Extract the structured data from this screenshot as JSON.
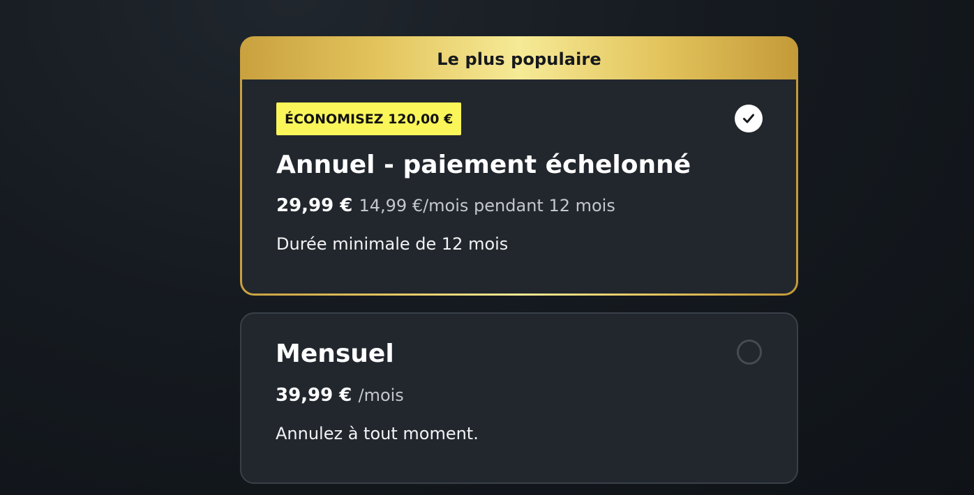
{
  "plans": {
    "annual": {
      "ribbon": "Le plus populaire",
      "savings_badge": "ÉCONOMISEZ 120,00 €",
      "title": "Annuel - paiement échelonné",
      "price": "29,99 €",
      "price_detail": "14,99 €/mois pendant 12 mois",
      "note": "Durée minimale de 12 mois",
      "selected": true
    },
    "monthly": {
      "title": "Mensuel",
      "price": "39,99 €",
      "price_detail": "/mois",
      "note": "Annulez à tout moment.",
      "selected": false
    }
  },
  "colors": {
    "accent_gold": "#e3c45d",
    "badge_yellow": "#faf65a",
    "card_background": "#22272e",
    "page_background": "#151a20"
  },
  "icons": {
    "selected": "check-icon",
    "unselected": "radio-empty-icon"
  }
}
